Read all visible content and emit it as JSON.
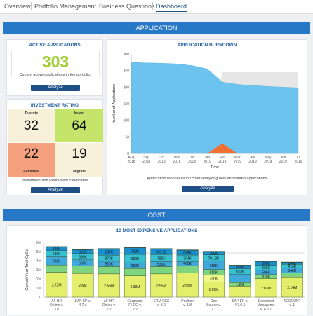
{
  "tabs": [
    "Overview",
    "Portfolio Management",
    "Business Questions",
    "Dashboard"
  ],
  "application_section": {
    "title": "APPLICATION"
  },
  "active_apps": {
    "title": "ACTIVE APPLICATIONS",
    "count": "303",
    "caption": "Current active applications in the portfolio",
    "button": "Analyze"
  },
  "investment": {
    "title": "INVESTMENT RATING",
    "tolerate": {
      "label": "Tolerate",
      "value": "32",
      "color": "#f7f1da"
    },
    "invest": {
      "label": "Invest",
      "value": "64",
      "color": "#c5e56a"
    },
    "eliminate": {
      "label": "Eliminate",
      "value": "22",
      "color": "#f5a17d"
    },
    "migrate": {
      "label": "Migrate",
      "value": "19",
      "color": "#f7f1da"
    },
    "caption": "Investment and Retirement candidates",
    "button": "Analyze"
  },
  "burndown": {
    "title": "APPLICATION BURNDOWN",
    "caption": "Application rationalization chart analyzing new and retired applications",
    "button": "Analyze"
  },
  "cost_section": {
    "title": "COST"
  },
  "expensive": {
    "title": "10 MOST EXPENSIVE APPLICATIONS"
  },
  "chart_data": [
    {
      "type": "area",
      "title": "APPLICATION BURNDOWN",
      "xlabel": "Time",
      "ylabel": "Number of Applications",
      "ylim": [
        0,
        300
      ],
      "yticks": [
        0,
        50,
        100,
        150,
        200,
        250,
        300
      ],
      "categories": [
        "Aug 2018",
        "Sep 2018",
        "Oct 2018",
        "Nov 2018",
        "Dec 2018",
        "Jan 2019",
        "Feb 2019",
        "Mar 2019",
        "Apr 2019",
        "May 2019",
        "Jun 2019",
        "Jul 2019"
      ],
      "series": [
        {
          "name": "",
          "color": "#6cc4ee",
          "values": [
            275,
            273,
            272,
            270,
            265,
            255,
            215,
            208,
            205,
            202,
            200,
            198
          ]
        },
        {
          "name": "",
          "color": "#f27030",
          "values": [
            0,
            0,
            0,
            0,
            0,
            0,
            30,
            0,
            0,
            0,
            0,
            0
          ]
        },
        {
          "name": "",
          "color": "#e6e6e6",
          "values": [
            0,
            0,
            0,
            0,
            0,
            0,
            245,
            245,
            245,
            245,
            245,
            245
          ]
        }
      ],
      "grid": false
    },
    {
      "type": "bar",
      "title": "10 MOST EXPENSIVE APPLICATIONS",
      "ylabel": "Current Year Total OpEx",
      "ylim": [
        0,
        6000000
      ],
      "ytick_labels": [
        "0",
        "1M",
        "2M",
        "3M",
        "4M",
        "5M",
        "6M"
      ],
      "categories": [
        "AF HR Online v. 3.0",
        "SAP EP v. 4.7.c",
        "AF HR Online v. 2.2",
        "Corporate FI-CO v. 2.2",
        "CRM CSS v. 3.2",
        "Position v. 1.8",
        "One Source v. 2.7",
        "SAP EP v. 4.7.0.1",
        "Document Manageme v. 6.2.1",
        "ACCOUNT v. 1"
      ],
      "stacked": true,
      "series": [
        {
          "name": "",
          "color": "#e3ee6a",
          "values": [
            2720000,
            2600000,
            2550000,
            2330000,
            2550000,
            2650000,
            1660000,
            1200000,
            2030000,
            2140000
          ]
        },
        {
          "name": "",
          "color": "#eef88a",
          "values": [
            0,
            0,
            0,
            0,
            0,
            0,
            750000,
            0,
            0,
            0
          ]
        },
        {
          "name": "",
          "color": "#7fd57f",
          "values": [
            800000,
            800000,
            800000,
            800000,
            800000,
            800000,
            610000,
            400000,
            440000,
            500000
          ]
        },
        {
          "name": "",
          "color": "#3fa9dc",
          "values": [
            900000,
            690000,
            580000,
            630000,
            530000,
            460000,
            915000,
            920000,
            506000,
            540000
          ]
        },
        {
          "name": "",
          "color": "#37c0d0",
          "values": [
            680000,
            690000,
            670000,
            930000,
            795000,
            704000,
            701300,
            596000,
            523000,
            416000
          ]
        },
        {
          "name": "",
          "color": "#1a8fcf",
          "values": [
            400000,
            400000,
            687000,
            713000,
            609500,
            525000,
            350000,
            350000,
            390000,
            200000
          ]
        },
        {
          "name": "",
          "color": "#0f6ea0",
          "values": [
            50000,
            50000,
            50000,
            50000,
            50000,
            50000,
            50000,
            50000,
            50000,
            50000
          ]
        }
      ],
      "segment_labels": [
        [
          "2.72M",
          "",
          "",
          "900K",
          "680K",
          "360K"
        ],
        [
          "2.6M",
          "",
          "",
          "690K",
          "690K",
          "697K"
        ],
        [
          "2.55M",
          "",
          "",
          "580K",
          "870K",
          "687K"
        ],
        [
          "2.33M",
          "",
          "",
          "630K",
          "930K",
          "713K"
        ],
        [
          "2.55M",
          "",
          "",
          "530K",
          "795K",
          "609.5K"
        ],
        [
          "2.65M",
          "",
          "",
          "460K",
          "704K",
          "525K"
        ],
        [
          "1.66M",
          "750K",
          "610K",
          "915K",
          "701.3K",
          "350K"
        ],
        [
          "",
          "",
          "1.2M",
          "",
          "920K",
          "596K"
        ],
        [
          "2.03M",
          "",
          "440K",
          "506K",
          "523K",
          "390K"
        ],
        [
          "2.14M",
          "",
          "",
          "540K",
          "416K",
          "200K"
        ]
      ]
    }
  ]
}
